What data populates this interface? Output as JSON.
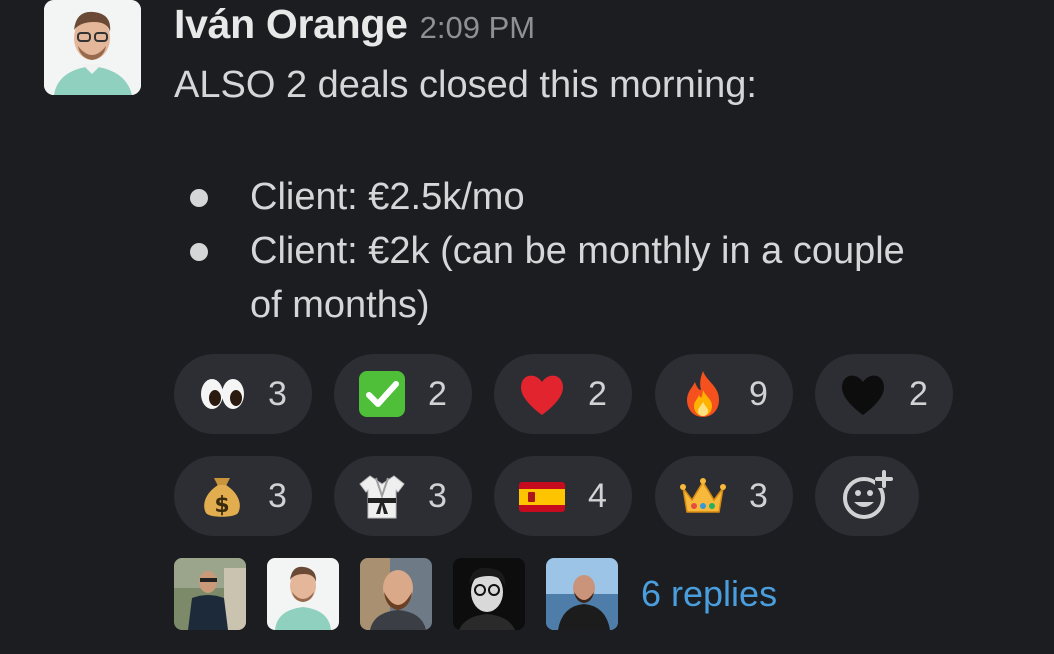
{
  "message": {
    "author": "Iván Orange",
    "time": "2:09 PM",
    "line1": "ALSO 2 deals closed this morning:",
    "bullets": [
      "Client: €2.5k/mo",
      "Client: €2k (can be monthly in a couple",
      "of months)"
    ]
  },
  "reactions": [
    {
      "icon": "eyes-emoji",
      "count": "3"
    },
    {
      "icon": "check-mark-emoji",
      "count": "2"
    },
    {
      "icon": "red-heart-emoji",
      "count": "2"
    },
    {
      "icon": "fire-emoji",
      "count": "9"
    },
    {
      "icon": "black-heart-emoji",
      "count": "2"
    },
    {
      "icon": "money-bag-emoji",
      "count": "3"
    },
    {
      "icon": "martial-arts-uniform-emoji",
      "count": "3"
    },
    {
      "icon": "spain-flag-emoji",
      "count": "4"
    },
    {
      "icon": "crown-emoji",
      "count": "3"
    }
  ],
  "add_reaction_icon": "add-reaction-icon",
  "thread": {
    "replies_label": "6 replies"
  },
  "colors": {
    "background": "#1b1d21",
    "pill": "#2c2e33",
    "link": "#4a9ede"
  }
}
